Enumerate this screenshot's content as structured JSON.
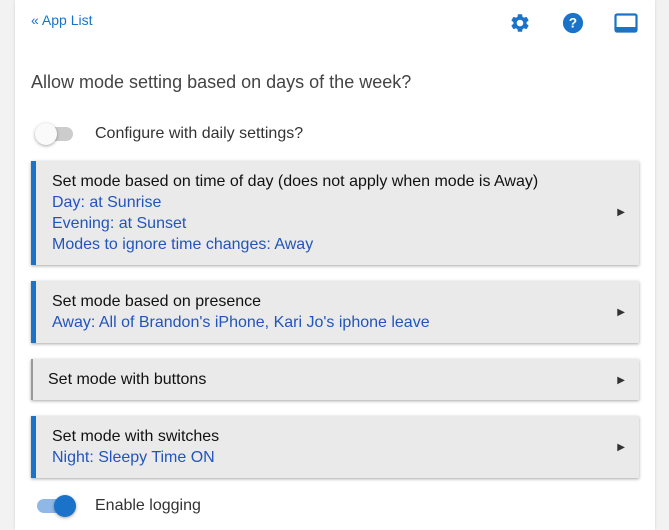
{
  "header": {
    "back_link": "« App List",
    "icons": [
      "gear-icon",
      "help-icon",
      "window-icon"
    ],
    "icon_color": "#1a73c8"
  },
  "main": {
    "question": "Allow mode setting based on days of the week?",
    "daily_toggle": {
      "label": "Configure with daily settings?",
      "on": false
    },
    "sections": [
      {
        "title": "Set mode based on time of day (does not apply when mode is Away)",
        "details": [
          "Day: at Sunrise",
          "Evening: at Sunset",
          "Modes to ignore time changes: Away"
        ]
      },
      {
        "title": "Set mode based on presence",
        "details": [
          "Away: All of Brandon's iPhone, Kari Jo's iphone leave"
        ]
      },
      {
        "title": "Set mode with buttons",
        "details": []
      },
      {
        "title": "Set mode with switches",
        "details": [
          "Night: Sleepy Time ON"
        ]
      }
    ],
    "logging_toggle": {
      "label": "Enable logging",
      "on": true
    }
  },
  "colors": {
    "accent": "#1a73c8",
    "detail_text": "#2255bb",
    "section_bg": "#eaeaea"
  }
}
